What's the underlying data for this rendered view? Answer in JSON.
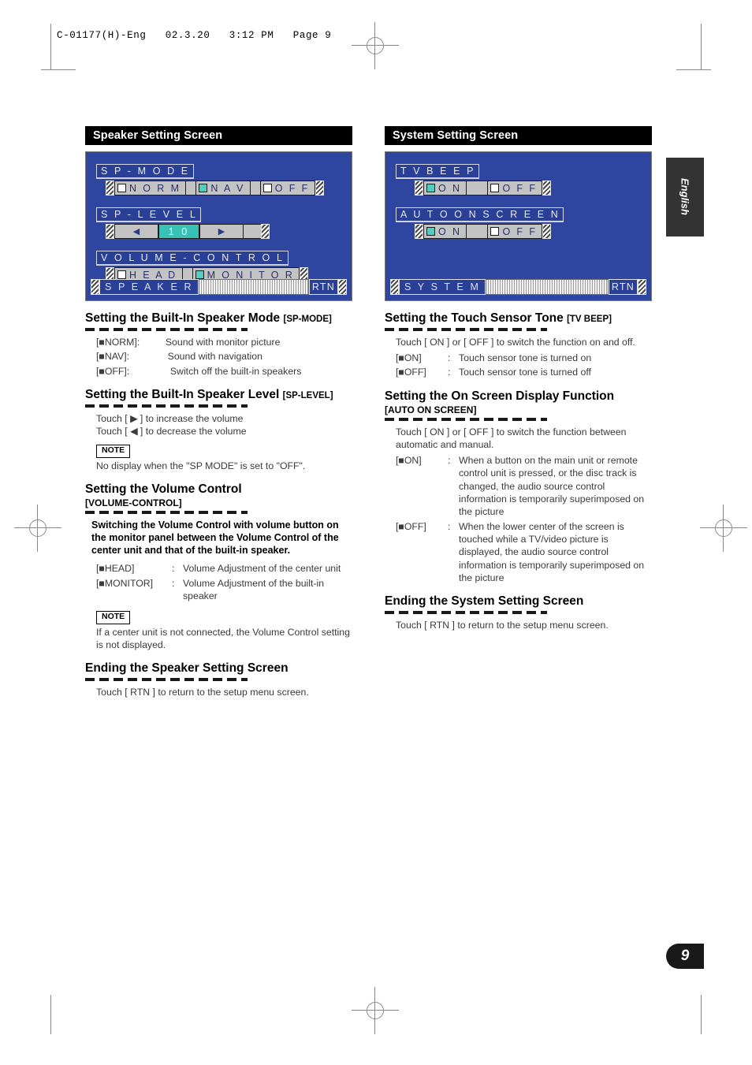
{
  "print_header": "C-01177(H)-Eng   02.3.20   3:12 PM   Page 9",
  "side_tab": {
    "label": "English"
  },
  "page_number": "9",
  "left_column": {
    "section_bar": "Speaker Setting Screen",
    "screen": {
      "groups": [
        {
          "title": "S P - M O D E",
          "options": [
            {
              "label": "N O R M",
              "selected": false
            },
            {
              "label": "N A V",
              "selected": true
            },
            {
              "label": "O F F",
              "selected": false
            }
          ]
        },
        {
          "title": "S P - L E V E L",
          "left_arrow": "◀",
          "value": "1 0",
          "right_arrow": "▶"
        },
        {
          "title": "V O L U M E - C O N T R O L",
          "options": [
            {
              "label": "H E A D",
              "selected": false
            },
            {
              "label": "M O N I T O R",
              "selected": true
            }
          ]
        }
      ],
      "status_title": "S P E A K E R",
      "return_button": "RTN"
    },
    "sections": [
      {
        "heading": "Setting the Built-In Speaker Mode",
        "code": "[SP-MODE]",
        "defs": [
          {
            "key": "[■NORM]",
            "sep": ":",
            "val": "Sound with monitor picture"
          },
          {
            "key": "[■NAV]",
            "sep": ":",
            "val": "Sound with navigation"
          },
          {
            "key": "[■OFF]",
            "sep": ":",
            "val": "Switch off the built-in speakers"
          }
        ]
      },
      {
        "heading": "Setting the Built-In Speaker Level",
        "code": "[SP-LEVEL]",
        "lines": [
          "Touch [ ▶ ] to increase the volume",
          "Touch [ ◀ ] to decrease the volume"
        ],
        "note_label": "NOTE",
        "note_text": "No display when the \"SP MODE\" is set to \"OFF\"."
      },
      {
        "heading": "Setting the Volume Control",
        "subheading": "[VOLUME-CONTROL]",
        "bold_para": "Switching the Volume Control with volume button on the monitor panel between the Volume Control of the center unit and that of the built-in speaker.",
        "defs": [
          {
            "key": "[■HEAD]",
            "sep": ":",
            "val": "Volume Adjustment of the center unit"
          },
          {
            "key": "[■MONITOR]",
            "sep": ":",
            "val": "Volume Adjustment of the built-in speaker"
          }
        ],
        "note_label": "NOTE",
        "note_text": "If a center unit is not connected, the Volume Control setting is not displayed."
      },
      {
        "heading": "Ending the Speaker Setting Screen",
        "lines": [
          "Touch [ RTN ] to return to the setup menu screen."
        ]
      }
    ]
  },
  "right_column": {
    "section_bar": "System Setting Screen",
    "screen": {
      "groups": [
        {
          "title": "T V   B E E P",
          "options": [
            {
              "label": "O  N",
              "selected": true
            },
            {
              "label": "O F F",
              "selected": false
            }
          ]
        },
        {
          "title": "A U T O   O N   S C R E E N",
          "options": [
            {
              "label": "O  N",
              "selected": true
            },
            {
              "label": "O F F",
              "selected": false
            }
          ]
        }
      ],
      "status_title": "S Y S T E M",
      "return_button": "RTN"
    },
    "sections": [
      {
        "heading": "Setting the Touch Sensor Tone",
        "code": "[TV BEEP]",
        "lines": [
          "Touch [ ON ] or [ OFF ] to switch the function on and off."
        ],
        "defs": [
          {
            "key": "[■ON]",
            "sep": ":",
            "val": "Touch sensor tone is turned on"
          },
          {
            "key": "[■OFF]",
            "sep": ":",
            "val": "Touch sensor tone is turned off"
          }
        ]
      },
      {
        "heading": "Setting the On Screen Display Function",
        "subheading": "[AUTO ON SCREEN]",
        "lines": [
          "Touch [ ON ] or [ OFF ] to switch the function between automatic and manual."
        ],
        "defs": [
          {
            "key": "[■ON]",
            "sep": ":",
            "val": "When a button on the main unit or remote control unit is pressed, or the disc track is changed, the audio source control information is temporarily superimposed on the picture"
          },
          {
            "key": "[■OFF]",
            "sep": ":",
            "val": "When the lower center of the screen is touched while a TV/video picture is displayed, the audio source control information is temporarily superimposed on the picture"
          }
        ]
      },
      {
        "heading": "Ending the System Setting Screen",
        "lines": [
          "Touch [ RTN ] to return to the setup menu screen."
        ]
      }
    ]
  },
  "colors": {
    "screen_background": "#2e46a0",
    "option_selected": "#52cdc0",
    "level_value": "#37c2b5",
    "header_bar": "#000000",
    "tab": "#333333"
  }
}
